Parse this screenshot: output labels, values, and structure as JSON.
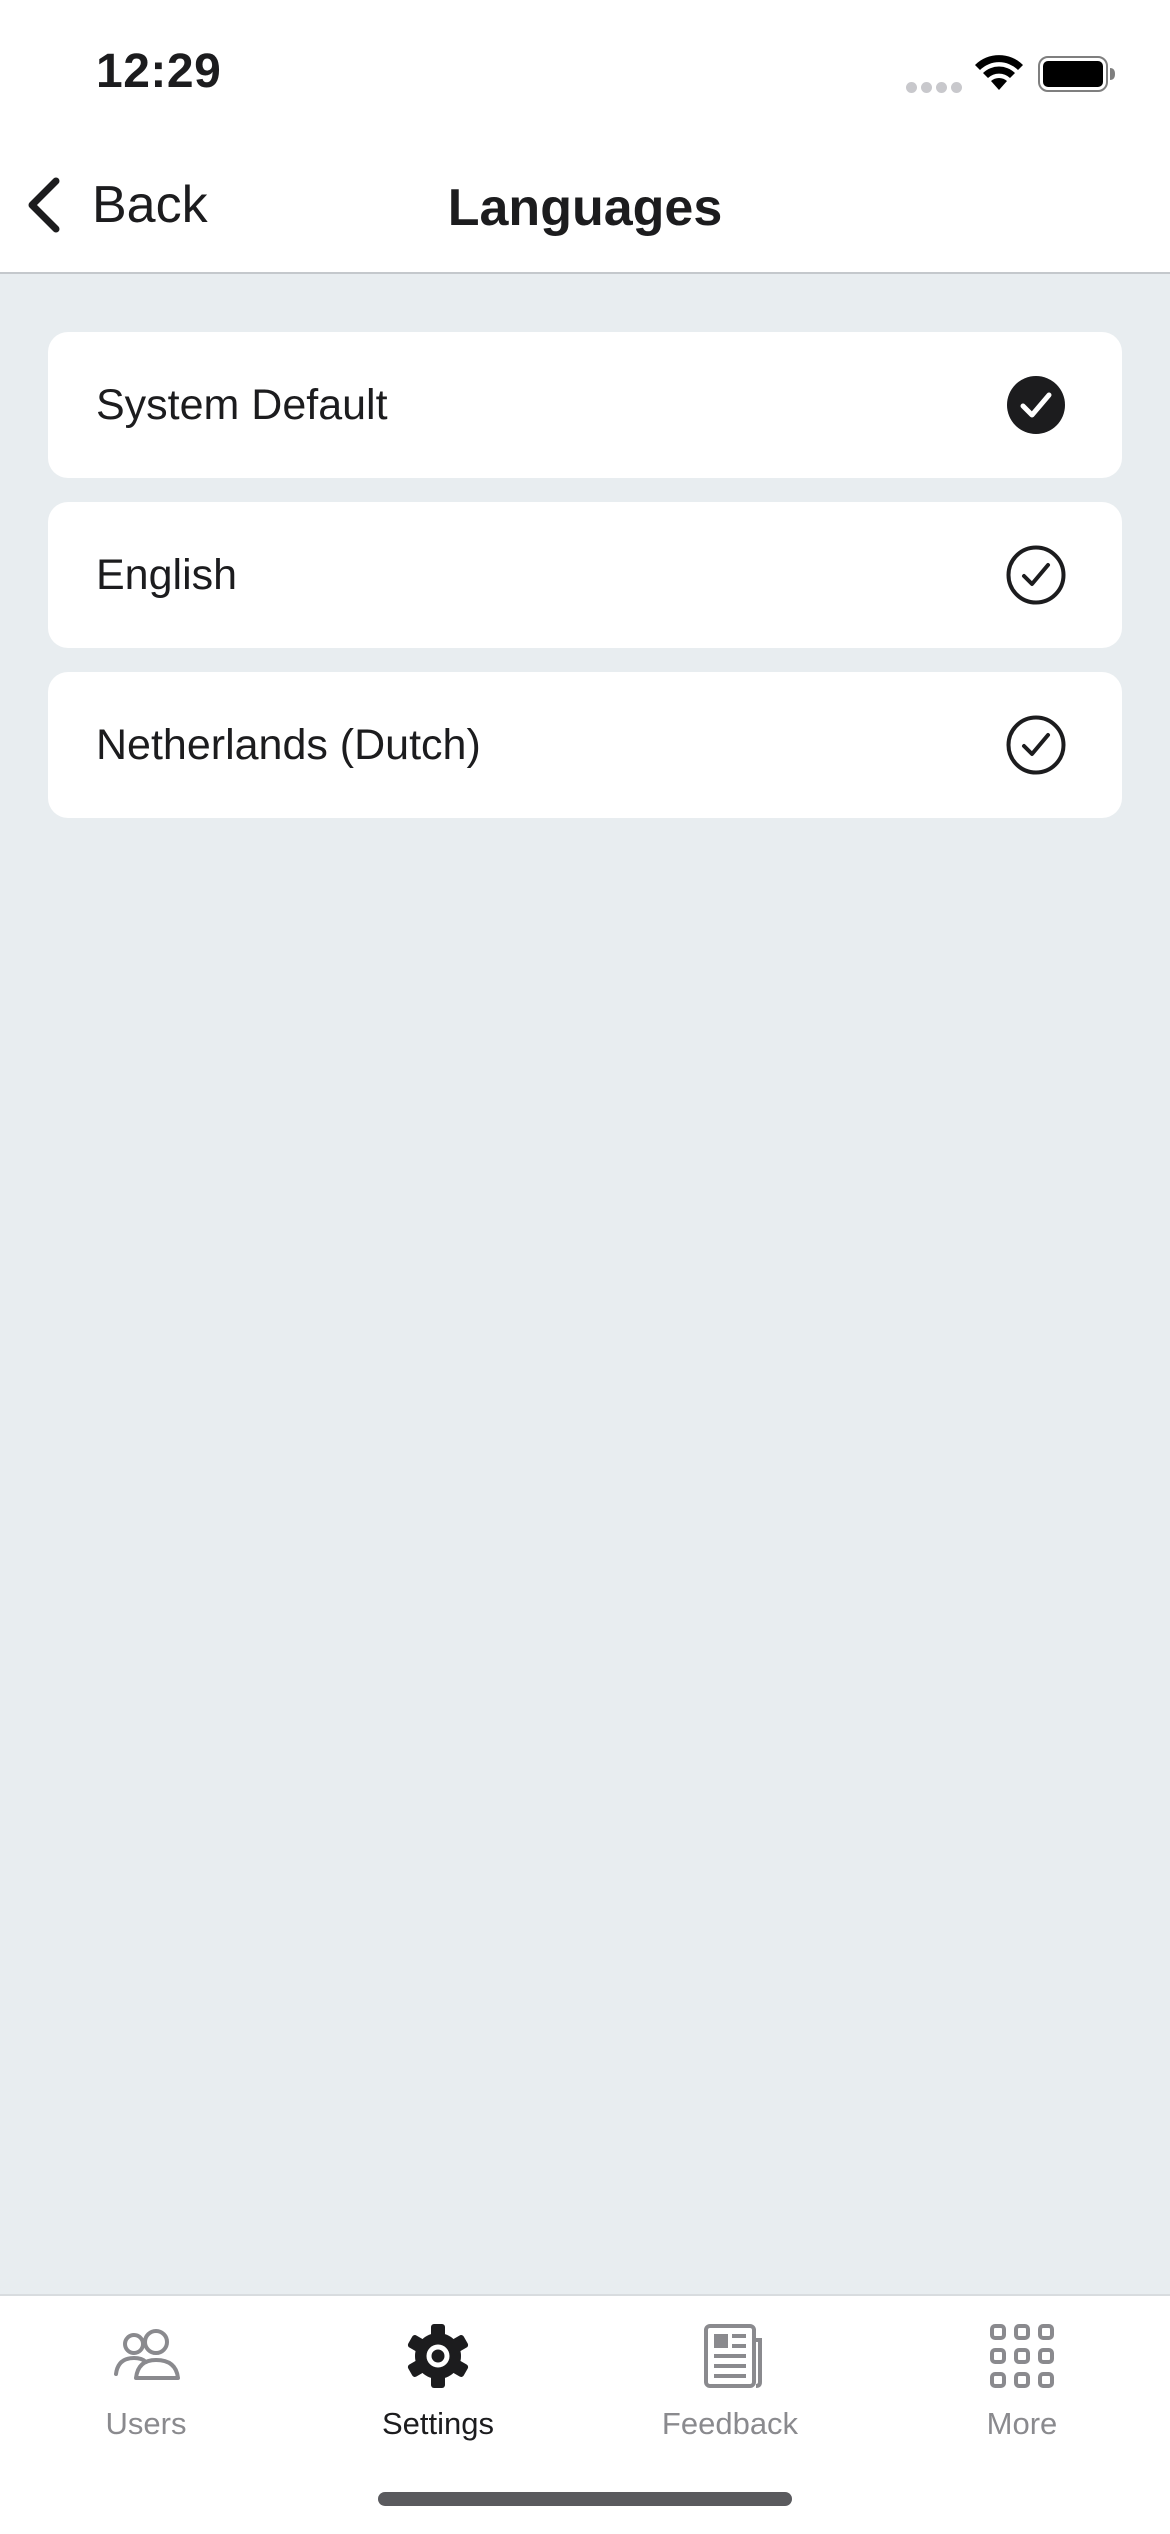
{
  "status_bar": {
    "time": "12:29"
  },
  "nav": {
    "back_label": "Back",
    "title": "Languages"
  },
  "languages": [
    {
      "label": "System Default",
      "selected": true
    },
    {
      "label": "English",
      "selected": false
    },
    {
      "label": "Netherlands (Dutch)",
      "selected": false
    }
  ],
  "tabs": [
    {
      "label": "Users",
      "icon": "users-icon",
      "active": false
    },
    {
      "label": "Settings",
      "icon": "gear-icon",
      "active": true
    },
    {
      "label": "Feedback",
      "icon": "newspaper-icon",
      "active": false
    },
    {
      "label": "More",
      "icon": "grid-icon",
      "active": false
    }
  ],
  "colors": {
    "background": "#e8edf0",
    "surface": "#ffffff",
    "text": "#1c1c1e",
    "inactive": "#8a8a8e"
  }
}
